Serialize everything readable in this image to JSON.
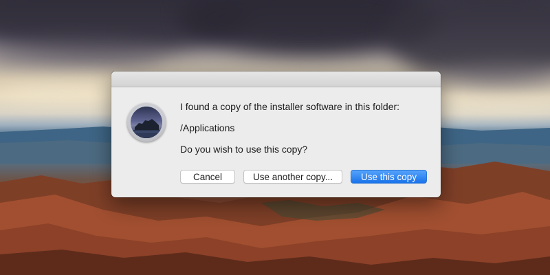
{
  "dialog": {
    "message_line1": "I found a copy of the installer software in this folder:",
    "folder_path": "/Applications",
    "question": "Do you wish to use this copy?",
    "buttons": {
      "cancel": "Cancel",
      "use_another": "Use another copy...",
      "use_this": "Use this copy"
    },
    "default_button": "use_this",
    "app_icon": "macos-catalina-installer-icon"
  },
  "colors": {
    "accent": "#1a73ea",
    "dialog_background": "#ececec"
  }
}
